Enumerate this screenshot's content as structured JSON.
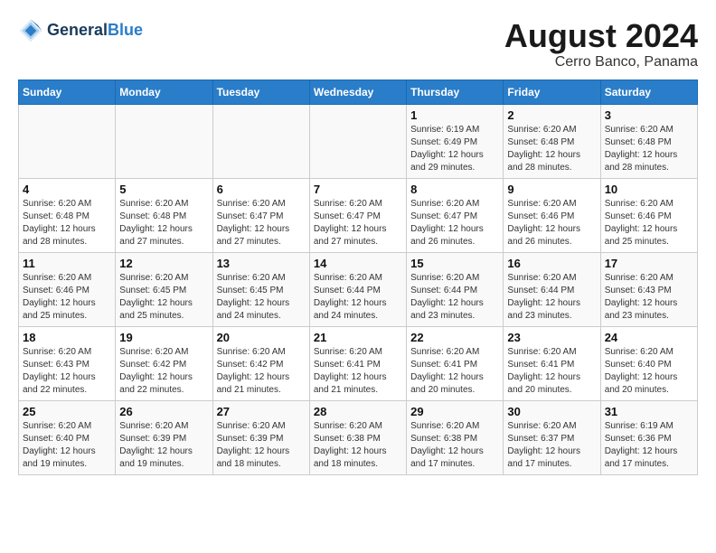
{
  "header": {
    "logo_line1": "General",
    "logo_line2": "Blue",
    "title": "August 2024",
    "subtitle": "Cerro Banco, Panama"
  },
  "days_of_week": [
    "Sunday",
    "Monday",
    "Tuesday",
    "Wednesday",
    "Thursday",
    "Friday",
    "Saturday"
  ],
  "weeks": [
    [
      {
        "day": "",
        "info": ""
      },
      {
        "day": "",
        "info": ""
      },
      {
        "day": "",
        "info": ""
      },
      {
        "day": "",
        "info": ""
      },
      {
        "day": "1",
        "info": "Sunrise: 6:19 AM\nSunset: 6:49 PM\nDaylight: 12 hours\nand 29 minutes."
      },
      {
        "day": "2",
        "info": "Sunrise: 6:20 AM\nSunset: 6:48 PM\nDaylight: 12 hours\nand 28 minutes."
      },
      {
        "day": "3",
        "info": "Sunrise: 6:20 AM\nSunset: 6:48 PM\nDaylight: 12 hours\nand 28 minutes."
      }
    ],
    [
      {
        "day": "4",
        "info": "Sunrise: 6:20 AM\nSunset: 6:48 PM\nDaylight: 12 hours\nand 28 minutes."
      },
      {
        "day": "5",
        "info": "Sunrise: 6:20 AM\nSunset: 6:48 PM\nDaylight: 12 hours\nand 27 minutes."
      },
      {
        "day": "6",
        "info": "Sunrise: 6:20 AM\nSunset: 6:47 PM\nDaylight: 12 hours\nand 27 minutes."
      },
      {
        "day": "7",
        "info": "Sunrise: 6:20 AM\nSunset: 6:47 PM\nDaylight: 12 hours\nand 27 minutes."
      },
      {
        "day": "8",
        "info": "Sunrise: 6:20 AM\nSunset: 6:47 PM\nDaylight: 12 hours\nand 26 minutes."
      },
      {
        "day": "9",
        "info": "Sunrise: 6:20 AM\nSunset: 6:46 PM\nDaylight: 12 hours\nand 26 minutes."
      },
      {
        "day": "10",
        "info": "Sunrise: 6:20 AM\nSunset: 6:46 PM\nDaylight: 12 hours\nand 25 minutes."
      }
    ],
    [
      {
        "day": "11",
        "info": "Sunrise: 6:20 AM\nSunset: 6:46 PM\nDaylight: 12 hours\nand 25 minutes."
      },
      {
        "day": "12",
        "info": "Sunrise: 6:20 AM\nSunset: 6:45 PM\nDaylight: 12 hours\nand 25 minutes."
      },
      {
        "day": "13",
        "info": "Sunrise: 6:20 AM\nSunset: 6:45 PM\nDaylight: 12 hours\nand 24 minutes."
      },
      {
        "day": "14",
        "info": "Sunrise: 6:20 AM\nSunset: 6:44 PM\nDaylight: 12 hours\nand 24 minutes."
      },
      {
        "day": "15",
        "info": "Sunrise: 6:20 AM\nSunset: 6:44 PM\nDaylight: 12 hours\nand 23 minutes."
      },
      {
        "day": "16",
        "info": "Sunrise: 6:20 AM\nSunset: 6:44 PM\nDaylight: 12 hours\nand 23 minutes."
      },
      {
        "day": "17",
        "info": "Sunrise: 6:20 AM\nSunset: 6:43 PM\nDaylight: 12 hours\nand 23 minutes."
      }
    ],
    [
      {
        "day": "18",
        "info": "Sunrise: 6:20 AM\nSunset: 6:43 PM\nDaylight: 12 hours\nand 22 minutes."
      },
      {
        "day": "19",
        "info": "Sunrise: 6:20 AM\nSunset: 6:42 PM\nDaylight: 12 hours\nand 22 minutes."
      },
      {
        "day": "20",
        "info": "Sunrise: 6:20 AM\nSunset: 6:42 PM\nDaylight: 12 hours\nand 21 minutes."
      },
      {
        "day": "21",
        "info": "Sunrise: 6:20 AM\nSunset: 6:41 PM\nDaylight: 12 hours\nand 21 minutes."
      },
      {
        "day": "22",
        "info": "Sunrise: 6:20 AM\nSunset: 6:41 PM\nDaylight: 12 hours\nand 20 minutes."
      },
      {
        "day": "23",
        "info": "Sunrise: 6:20 AM\nSunset: 6:41 PM\nDaylight: 12 hours\nand 20 minutes."
      },
      {
        "day": "24",
        "info": "Sunrise: 6:20 AM\nSunset: 6:40 PM\nDaylight: 12 hours\nand 20 minutes."
      }
    ],
    [
      {
        "day": "25",
        "info": "Sunrise: 6:20 AM\nSunset: 6:40 PM\nDaylight: 12 hours\nand 19 minutes."
      },
      {
        "day": "26",
        "info": "Sunrise: 6:20 AM\nSunset: 6:39 PM\nDaylight: 12 hours\nand 19 minutes."
      },
      {
        "day": "27",
        "info": "Sunrise: 6:20 AM\nSunset: 6:39 PM\nDaylight: 12 hours\nand 18 minutes."
      },
      {
        "day": "28",
        "info": "Sunrise: 6:20 AM\nSunset: 6:38 PM\nDaylight: 12 hours\nand 18 minutes."
      },
      {
        "day": "29",
        "info": "Sunrise: 6:20 AM\nSunset: 6:38 PM\nDaylight: 12 hours\nand 17 minutes."
      },
      {
        "day": "30",
        "info": "Sunrise: 6:20 AM\nSunset: 6:37 PM\nDaylight: 12 hours\nand 17 minutes."
      },
      {
        "day": "31",
        "info": "Sunrise: 6:19 AM\nSunset: 6:36 PM\nDaylight: 12 hours\nand 17 minutes."
      }
    ]
  ]
}
